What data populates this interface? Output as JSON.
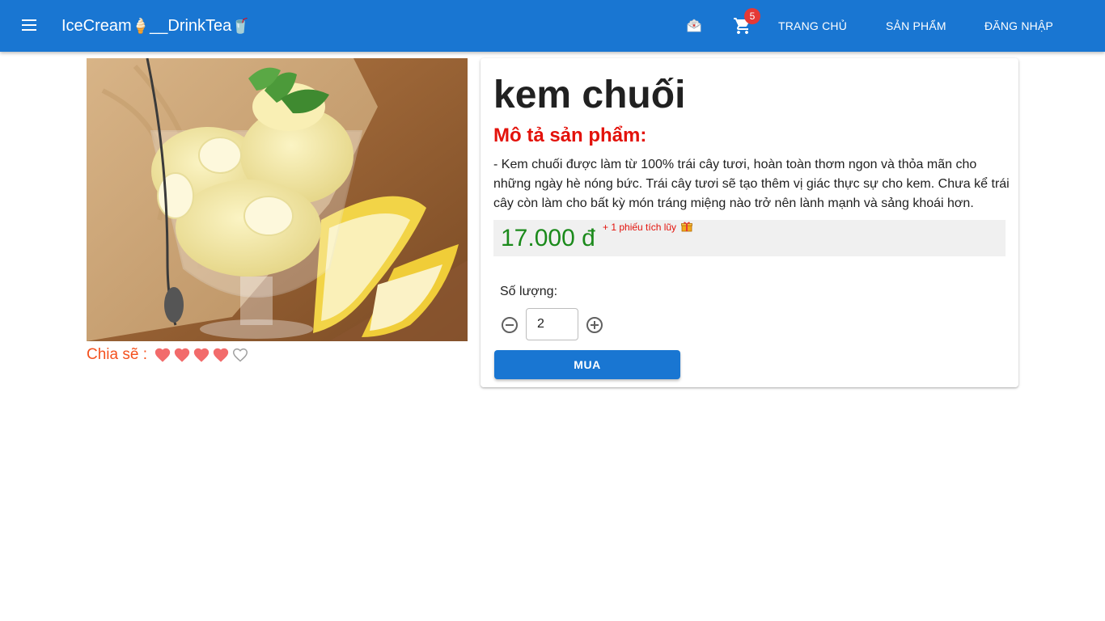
{
  "appbar": {
    "brand_prefix": "IceCream",
    "brand_glyph_1": "🍦",
    "brand_middle": "__DrinkTea",
    "brand_glyph_2": "🥤",
    "menu_icon": "hamburger-menu-icon",
    "mail_icon": "envelope-icon",
    "cart_icon": "shopping-cart-icon",
    "cart_count": "5",
    "nav": {
      "home": "TRANG CHỦ",
      "products": "SẢN PHẨM",
      "login": "ĐĂNG NHẬP"
    },
    "color": "#1976d2"
  },
  "product": {
    "title": "kem chuối",
    "description_heading": "Mô tả sản phẩm:",
    "description": "- Kem chuối được làm từ 100% trái cây tươi, hoàn toàn thơm ngon và thỏa mãn cho những ngày hè nóng bức. Trái cây tươi sẽ tạo thêm vị giác thực sự cho kem. Chưa kể trái cây còn làm cho bất kỳ món tráng miệng nào trở nên lành mạnh và sảng khoái hơn.",
    "price": "17.000 đ",
    "bonus": "+ 1 phiếu tích lũy",
    "bonus_icon": "gift-icon",
    "image": "banana-ice-cream-photo",
    "colors": {
      "title": "#212121",
      "heading": "#e3120b",
      "price": "#1b8a1b"
    }
  },
  "share": {
    "label": "Chia sẽ :",
    "rating": 4,
    "max": 5,
    "icon": "heart-icon"
  },
  "quantity": {
    "label": "Số lượng:",
    "value": "2",
    "minus_icon": "minus-circle-icon",
    "plus_icon": "plus-circle-icon"
  },
  "buy": {
    "label": "MUA"
  }
}
